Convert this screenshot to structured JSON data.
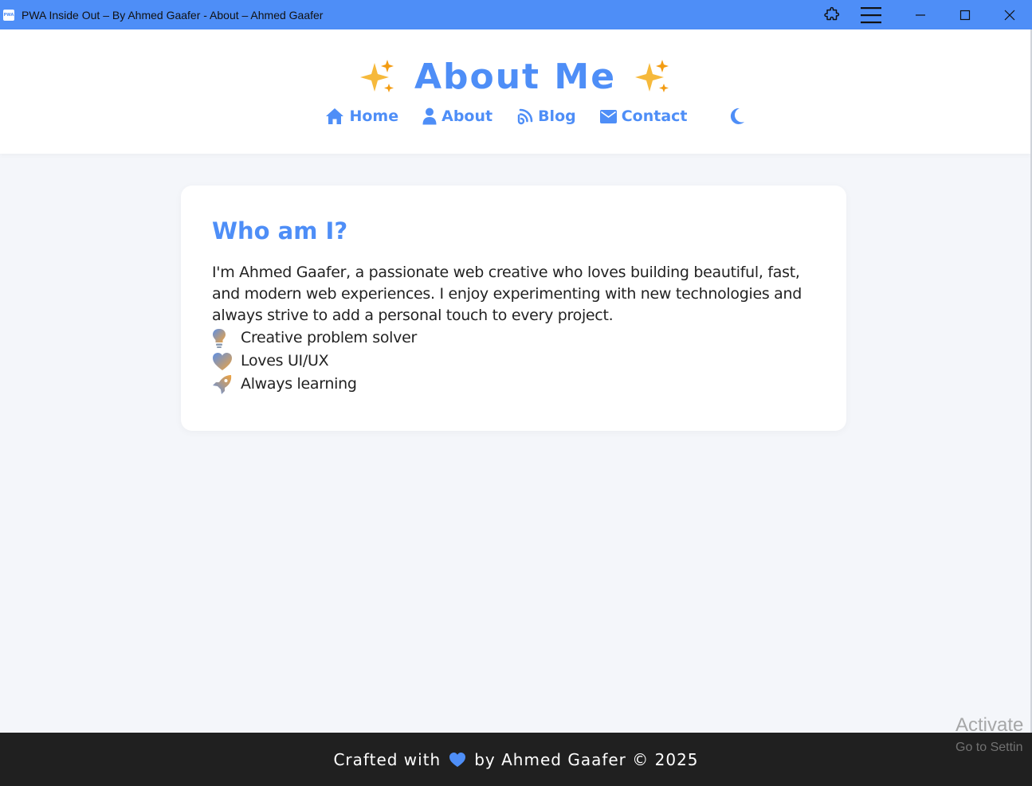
{
  "window": {
    "app_icon_text": "PWA",
    "title": "PWA Inside Out – By Ahmed Gaafer - About – Ahmed Gaafer",
    "controls": [
      "extensions-icon",
      "menu-icon",
      "minimize-icon",
      "maximize-icon",
      "close-icon"
    ]
  },
  "header": {
    "title": "About Me",
    "title_emoji": "sparkles",
    "nav": [
      {
        "label": "Home",
        "icon": "home-icon"
      },
      {
        "label": "About",
        "icon": "user-icon"
      },
      {
        "label": "Blog",
        "icon": "blog-icon"
      },
      {
        "label": "Contact",
        "icon": "envelope-icon"
      }
    ],
    "theme_toggle_icon": "moon-icon"
  },
  "card": {
    "heading": "Who am I?",
    "paragraph": "I'm Ahmed Gaafer, a passionate web creative who loves building beautiful, fast, and modern web experiences. I enjoy experimenting with new technologies and always strive to add a personal touch to every project.",
    "features": [
      {
        "label": "Creative problem solver",
        "icon": "lightbulb-icon"
      },
      {
        "label": "Loves UI/UX",
        "icon": "heart-icon"
      },
      {
        "label": "Always learning",
        "icon": "rocket-icon"
      }
    ]
  },
  "footer": {
    "before": "Crafted with",
    "after": "by Ahmed Gaafer © 2025"
  },
  "watermark": {
    "line1": "Activate",
    "line2": "Go to Settin"
  },
  "colors": {
    "accent": "#4e8ef7",
    "titlebar": "#4e8ef7",
    "page_bg": "#f4f6fa",
    "footer_bg": "#202020"
  }
}
